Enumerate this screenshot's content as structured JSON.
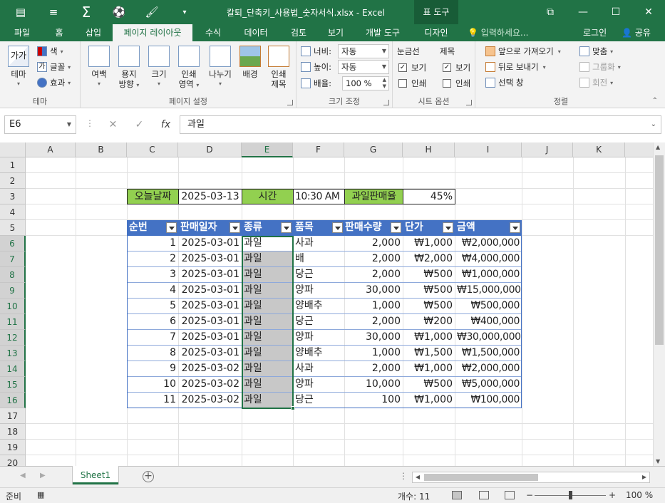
{
  "titlebar": {
    "title": "칼퇴_단축키_사용법_숫자서식.xlsx - Excel",
    "context_tab": "표 도구",
    "qat": [
      "save-icon",
      "undo-icon",
      "autosum-icon",
      "ball-icon",
      "brush-icon",
      "customize-icon"
    ]
  },
  "tabs": {
    "items": [
      "파일",
      "홈",
      "삽입",
      "페이지 레이아웃",
      "수식",
      "데이터",
      "검토",
      "보기",
      "개발 도구",
      "디자인"
    ],
    "tell_me": "입력하세요...",
    "login": "로그인",
    "share": "공유"
  },
  "ribbon": {
    "theme_group": {
      "label": "테마",
      "theme_btn": "테마",
      "colors": "색",
      "fonts": "글꼴",
      "effects": "효과"
    },
    "page_setup_group": {
      "label": "페이지 설정",
      "margins": [
        "여백"
      ],
      "orientation": [
        "용지",
        "방향"
      ],
      "size": [
        "크기"
      ],
      "print_area": [
        "인쇄",
        "영역"
      ],
      "breaks": [
        "나누기"
      ],
      "background": [
        "배경"
      ],
      "print_titles": [
        "인쇄",
        "제목"
      ]
    },
    "scale_group": {
      "label": "크기 조정",
      "width_label": "너비:",
      "width_value": "자동",
      "height_label": "높이:",
      "height_value": "자동",
      "scale_label": "배율:",
      "scale_value": "100 %"
    },
    "sheet_options_group": {
      "label": "시트 옵션",
      "gridlines": "눈금선",
      "headings": "제목",
      "view": "보기",
      "print": "인쇄"
    },
    "arrange_group": {
      "label": "정렬",
      "bring_forward": "앞으로 가져오기",
      "send_backward": "뒤로 보내기",
      "selection_pane": "선택 창",
      "align": "맞춤",
      "group": "그룹화",
      "rotate": "회전"
    }
  },
  "formula_bar": {
    "name_box": "E6",
    "formula": "과일"
  },
  "columns": [
    "A",
    "B",
    "C",
    "D",
    "E",
    "F",
    "G",
    "H",
    "I",
    "J",
    "K"
  ],
  "rows": [
    "1",
    "2",
    "3",
    "4",
    "5",
    "6",
    "7",
    "8",
    "9",
    "10",
    "11",
    "12",
    "13",
    "14",
    "15",
    "16",
    "17",
    "18",
    "19",
    "20"
  ],
  "info_row": {
    "today_label": "오늘날짜",
    "today_value": "2025-03-13",
    "time_label": "시간",
    "time_value": "10:30 AM",
    "ratio_label": "과일판매율",
    "ratio_value": "45%"
  },
  "table": {
    "headers": [
      "순번",
      "판매일자",
      "종류",
      "품목",
      "판매수량",
      "단가",
      "금액"
    ],
    "rows": [
      [
        "1",
        "2025-03-01",
        "과일",
        "사과",
        "2,000",
        "₩1,000",
        "₩2,000,000"
      ],
      [
        "2",
        "2025-03-01",
        "과일",
        "배",
        "2,000",
        "₩2,000",
        "₩4,000,000"
      ],
      [
        "3",
        "2025-03-01",
        "과일",
        "당근",
        "2,000",
        "₩500",
        "₩1,000,000"
      ],
      [
        "4",
        "2025-03-01",
        "과일",
        "양파",
        "30,000",
        "₩500",
        "₩15,000,000"
      ],
      [
        "5",
        "2025-03-01",
        "과일",
        "양배추",
        "1,000",
        "₩500",
        "₩500,000"
      ],
      [
        "6",
        "2025-03-01",
        "과일",
        "당근",
        "2,000",
        "₩200",
        "₩400,000"
      ],
      [
        "7",
        "2025-03-01",
        "과일",
        "양파",
        "30,000",
        "₩1,000",
        "₩30,000,000"
      ],
      [
        "8",
        "2025-03-01",
        "과일",
        "양배추",
        "1,000",
        "₩1,500",
        "₩1,500,000"
      ],
      [
        "9",
        "2025-03-02",
        "과일",
        "사과",
        "2,000",
        "₩1,000",
        "₩2,000,000"
      ],
      [
        "10",
        "2025-03-02",
        "과일",
        "양파",
        "10,000",
        "₩500",
        "₩5,000,000"
      ],
      [
        "11",
        "2025-03-02",
        "과일",
        "당근",
        "100",
        "₩1,000",
        "₩100,000"
      ]
    ]
  },
  "sheet_tabs": {
    "active": "Sheet1"
  },
  "status": {
    "ready": "준비",
    "count": "개수: 11",
    "zoom": "100 %"
  }
}
